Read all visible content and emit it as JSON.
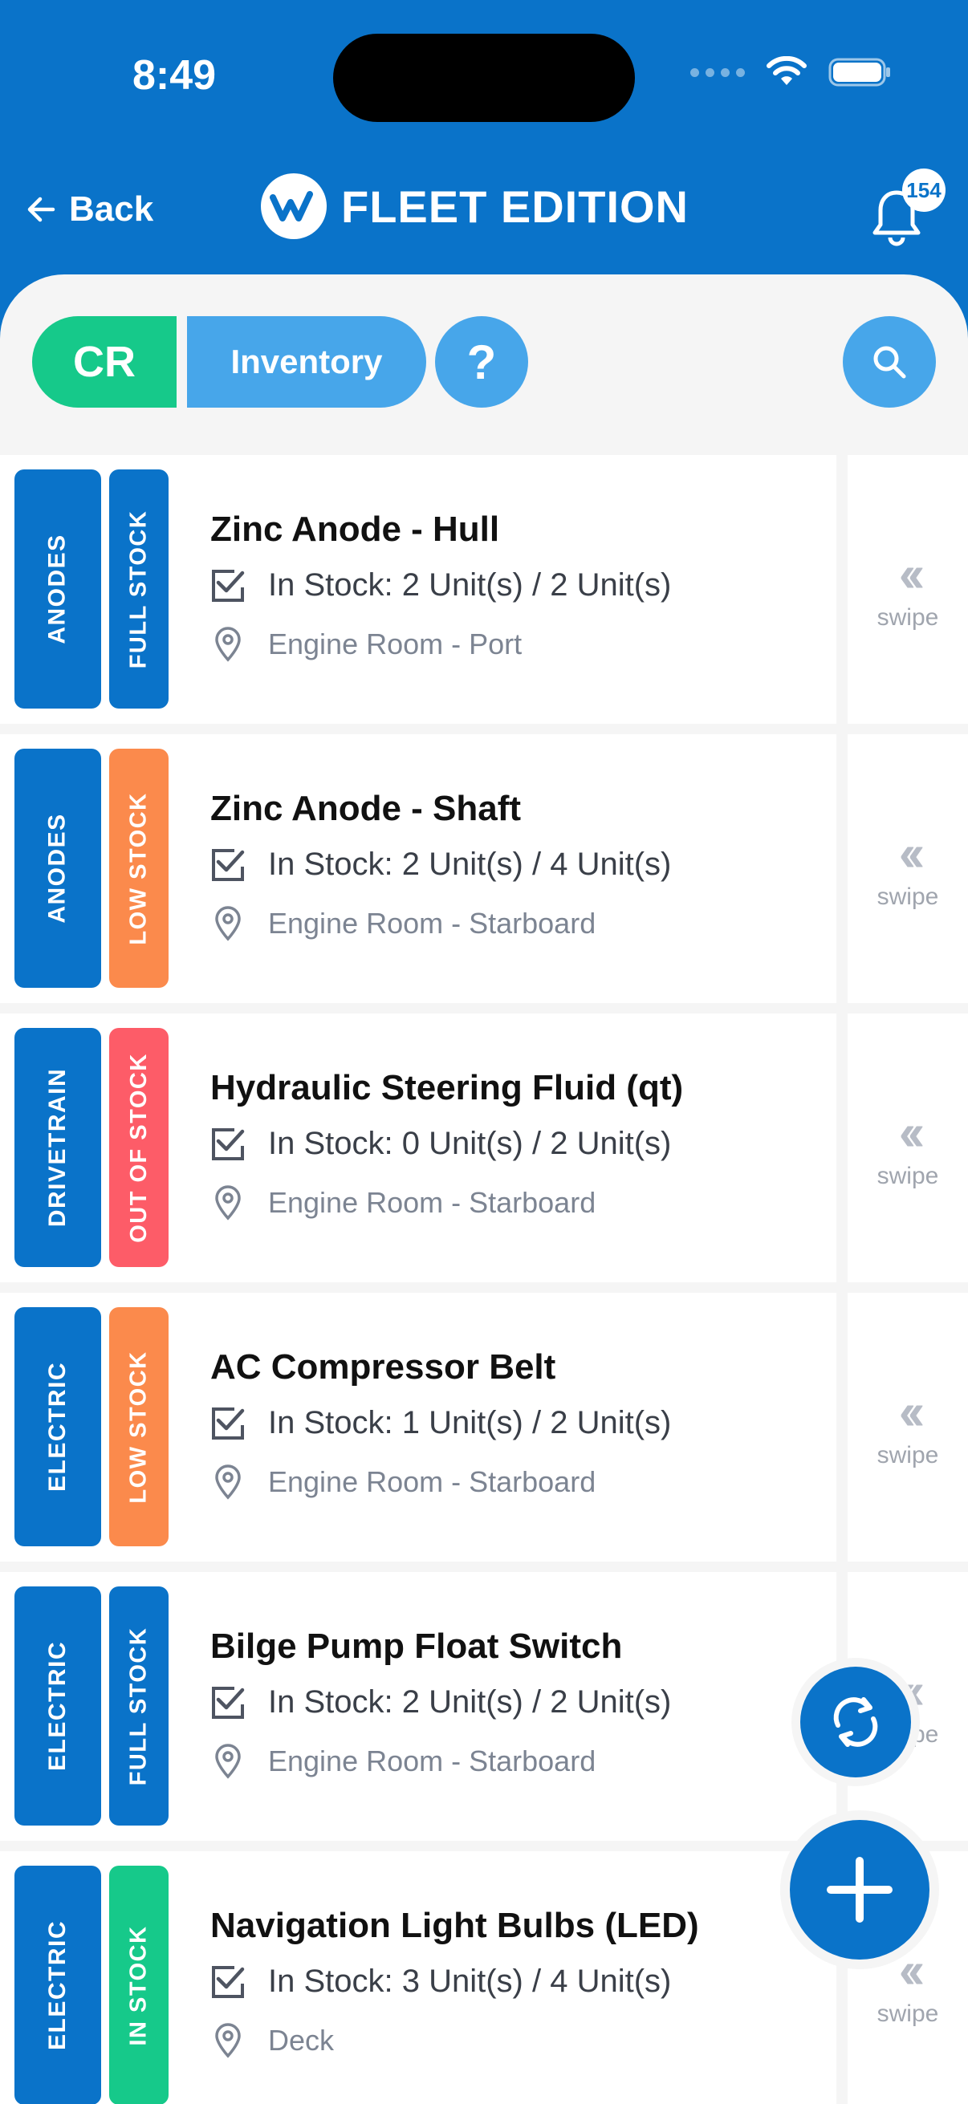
{
  "status_bar": {
    "time": "8:49"
  },
  "header": {
    "back_label": "Back",
    "brand_name": "FLEET EDITION",
    "notification_count": "154"
  },
  "toolbar": {
    "cr_label": "CR",
    "inventory_label": "Inventory",
    "help_label": "?"
  },
  "swipe_label": "swipe",
  "colors": {
    "brand_blue": "#0a73c9",
    "light_blue": "#47a6ea",
    "full_stock": "#0a73c9",
    "low_stock": "#fb8a4c",
    "out_of_stock": "#fd5c68",
    "in_stock": "#16c98a"
  },
  "items": [
    {
      "category": "ANODES",
      "stock_status": "FULL STOCK",
      "status_color": "#0a73c9",
      "name": "Zinc Anode - Hull",
      "stock": "In Stock: 2 Unit(s) / 2 Unit(s)",
      "location": "Engine Room - Port"
    },
    {
      "category": "ANODES",
      "stock_status": "LOW STOCK",
      "status_color": "#fb8a4c",
      "name": "Zinc Anode - Shaft",
      "stock": "In Stock: 2 Unit(s) / 4 Unit(s)",
      "location": "Engine Room - Starboard"
    },
    {
      "category": "DRIVETRAIN",
      "stock_status": "OUT OF STOCK",
      "status_color": "#fd5c68",
      "name": "Hydraulic Steering Fluid (qt)",
      "stock": "In Stock: 0 Unit(s) / 2 Unit(s)",
      "location": "Engine Room - Starboard"
    },
    {
      "category": "ELECTRIC",
      "stock_status": "LOW STOCK",
      "status_color": "#fb8a4c",
      "name": "AC Compressor Belt",
      "stock": "In Stock: 1 Unit(s) / 2 Unit(s)",
      "location": "Engine Room - Starboard"
    },
    {
      "category": "ELECTRIC",
      "stock_status": "FULL STOCK",
      "status_color": "#0a73c9",
      "name": "Bilge Pump Float Switch",
      "stock": "In Stock: 2 Unit(s) / 2 Unit(s)",
      "location": "Engine Room - Starboard"
    },
    {
      "category": "ELECTRIC",
      "stock_status": "IN STOCK",
      "status_color": "#16c98a",
      "name": "Navigation Light Bulbs (LED)",
      "stock": "In Stock: 3 Unit(s) / 4 Unit(s)",
      "location": "Deck"
    }
  ]
}
